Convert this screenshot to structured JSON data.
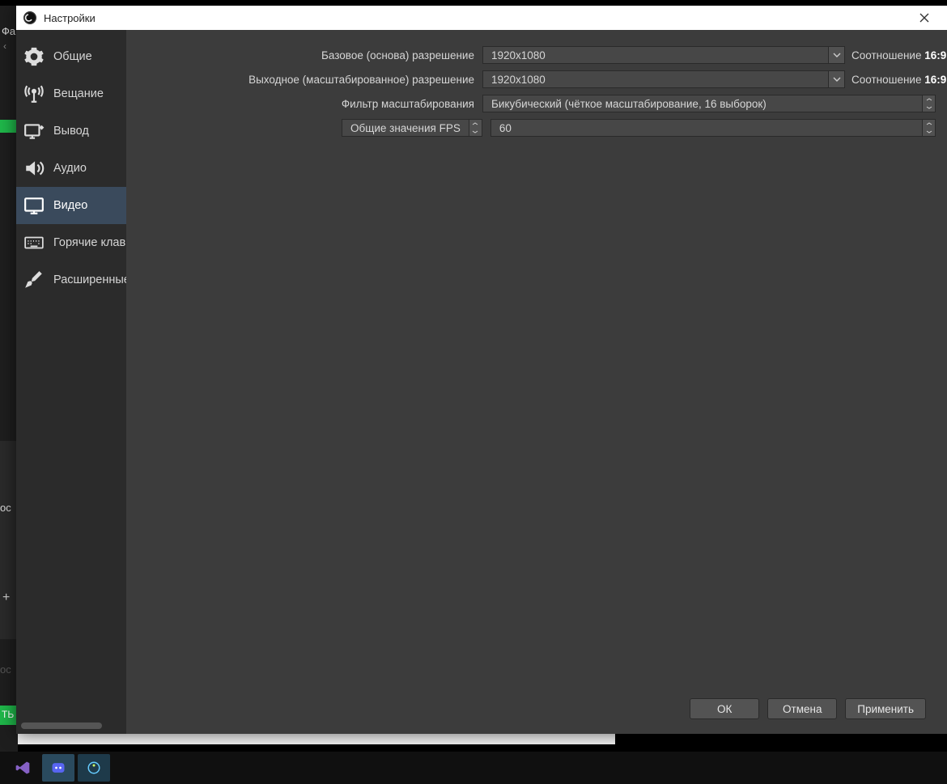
{
  "window": {
    "title": "Настройки"
  },
  "sidebar": {
    "items": [
      {
        "label": "Общие"
      },
      {
        "label": "Вещание"
      },
      {
        "label": "Вывод"
      },
      {
        "label": "Аудио"
      },
      {
        "label": "Видео"
      },
      {
        "label": "Горячие клавиши"
      },
      {
        "label": "Расширенные"
      }
    ]
  },
  "form": {
    "base_res_label": "Базовое (основа) разрешение",
    "base_res_value": "1920x1080",
    "base_res_aspect_label": "Соотношение ",
    "base_res_aspect_value": "16:9",
    "out_res_label": "Выходное (масштабированное) разрешение",
    "out_res_value": "1920x1080",
    "out_res_aspect_label": "Соотношение ",
    "out_res_aspect_value": "16:9",
    "filter_label": "Фильтр масштабирования",
    "filter_value": "Бикубический (чёткое масштабирование, 16 выборок)",
    "fps_mode_label": "Общие значения FPS",
    "fps_value": "60"
  },
  "buttons": {
    "ok": "ОК",
    "cancel": "Отмена",
    "apply": "Применить"
  },
  "bg": {
    "fa": "Фа",
    "arrow": "‹",
    "os": "ос",
    "os2": "ос",
    "tb": "ТЬ",
    "plus": "+"
  }
}
